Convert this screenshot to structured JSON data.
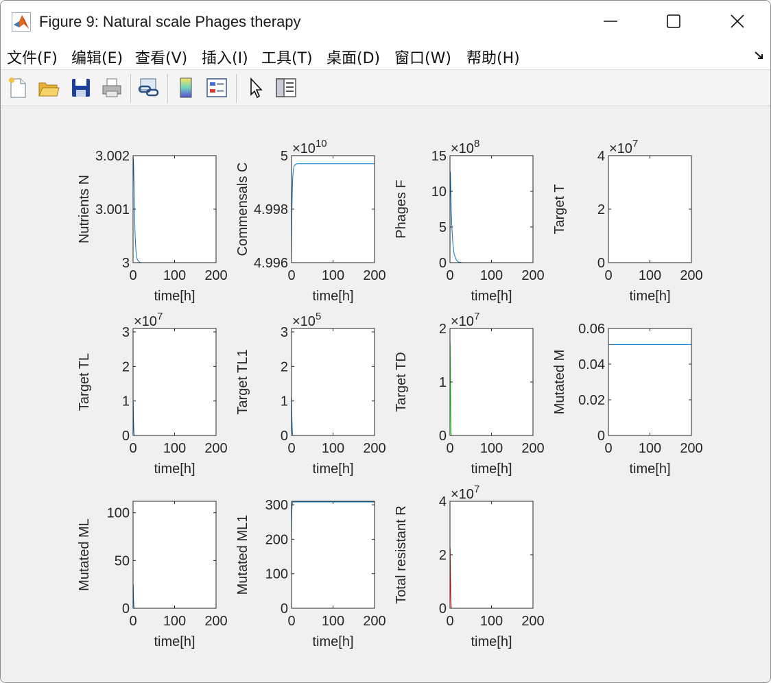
{
  "window": {
    "title": "Figure 9: Natural scale Phages therapy"
  },
  "menu": [
    {
      "label": "文件(F)",
      "mnemonic": "F"
    },
    {
      "label": "编辑(E)",
      "mnemonic": "E"
    },
    {
      "label": "查看(V)",
      "mnemonic": "V"
    },
    {
      "label": "插入(I)",
      "mnemonic": "I"
    },
    {
      "label": "工具(T)",
      "mnemonic": "T"
    },
    {
      "label": "桌面(D)",
      "mnemonic": "D"
    },
    {
      "label": "窗口(W)",
      "mnemonic": "W"
    },
    {
      "label": "帮助(H)",
      "mnemonic": "H"
    }
  ],
  "toolbar": {
    "icons": [
      "new-figure-icon",
      "open-file-icon",
      "save-icon",
      "print-icon",
      "link-plot-icon",
      "colorbar-icon",
      "legend-icon",
      "pointer-icon",
      "property-inspector-icon"
    ]
  },
  "colors": {
    "blue": "#0072bd",
    "green": "#00ff00",
    "red": "#ff0000"
  },
  "chart_data": [
    {
      "type": "line",
      "ylabel": "Nutrients N",
      "xlabel": "time[h]",
      "xlim": [
        0,
        200
      ],
      "ylim": [
        3,
        3.002
      ],
      "yticks": [
        "3",
        "3.001",
        "3.002"
      ],
      "xticks": [
        "0",
        "100",
        "200"
      ],
      "exponent": "",
      "color": "#0072bd",
      "series": [
        {
          "x": [
            0,
            1,
            2,
            3,
            4,
            5,
            7,
            10,
            15,
            20,
            30,
            200
          ],
          "y": [
            3.002,
            3.0019,
            3.0016,
            3.0012,
            3.0008,
            3.0005,
            3.0002,
            3.00006,
            3.00001,
            3.0,
            3.0,
            3.0
          ]
        }
      ]
    },
    {
      "type": "line",
      "ylabel": "Commensals C",
      "xlabel": "time[h]",
      "xlim": [
        0,
        200
      ],
      "ylim": [
        4.996,
        5
      ],
      "yticks": [
        "4.996",
        "4.998",
        "5"
      ],
      "xticks": [
        "0",
        "100",
        "200"
      ],
      "exponent": "10",
      "color": "#0072bd",
      "series": [
        {
          "x": [
            0,
            1,
            2,
            3,
            4,
            6,
            8,
            10,
            15,
            20,
            30,
            200
          ],
          "y": [
            4.9961,
            4.998,
            4.9988,
            4.9992,
            4.9994,
            4.9996,
            4.99965,
            4.99968,
            4.9997,
            4.9997,
            4.9997,
            4.9997
          ]
        }
      ]
    },
    {
      "type": "line",
      "ylabel": "Phages F",
      "xlabel": "time[h]",
      "xlim": [
        0,
        200
      ],
      "ylim": [
        0,
        15
      ],
      "yticks": [
        "0",
        "5",
        "10",
        "15"
      ],
      "xticks": [
        "0",
        "100",
        "200"
      ],
      "exponent": "8",
      "color": "#0072bd",
      "series": [
        {
          "x": [
            0,
            0.5,
            1,
            2,
            3,
            5,
            7,
            10,
            15,
            20,
            30,
            200
          ],
          "y": [
            0,
            12.8,
            12.5,
            10,
            7.5,
            4.5,
            2.6,
            1.2,
            0.4,
            0.1,
            0,
            0
          ]
        }
      ]
    },
    {
      "type": "line",
      "ylabel": "Target T",
      "xlabel": "time[h]",
      "xlim": [
        0,
        200
      ],
      "ylim": [
        0,
        4
      ],
      "yticks": [
        "0",
        "2",
        "4"
      ],
      "xticks": [
        "0",
        "100",
        "200"
      ],
      "exponent": "7",
      "color": "#0072bd",
      "series": [
        {
          "x": [
            0,
            200
          ],
          "y": [
            0,
            0
          ]
        }
      ]
    },
    {
      "type": "line",
      "ylabel": "Target TL",
      "xlabel": "time[h]",
      "xlim": [
        0,
        200
      ],
      "ylim": [
        0,
        3.1
      ],
      "yticks": [
        "0",
        "1",
        "2",
        "3"
      ],
      "xticks": [
        "0",
        "100",
        "200"
      ],
      "exponent": "7",
      "color": "#0072bd",
      "series": [
        {
          "x": [
            0,
            0.5,
            1,
            2,
            3,
            200
          ],
          "y": [
            0,
            1.0,
            0.5,
            0.1,
            0,
            0
          ]
        }
      ]
    },
    {
      "type": "line",
      "ylabel": "Target TL1",
      "xlabel": "time[h]",
      "xlim": [
        0,
        200
      ],
      "ylim": [
        0,
        3.1
      ],
      "yticks": [
        "0",
        "1",
        "2",
        "3"
      ],
      "xticks": [
        "0",
        "100",
        "200"
      ],
      "exponent": "5",
      "color": "#0072bd",
      "series": [
        {
          "x": [
            0,
            0.5,
            1,
            2,
            3,
            200
          ],
          "y": [
            0,
            1.1,
            0.5,
            0.1,
            0,
            0
          ]
        }
      ]
    },
    {
      "type": "line",
      "ylabel": "Target TD",
      "xlabel": "time[h]",
      "xlim": [
        0,
        200
      ],
      "ylim": [
        0,
        2
      ],
      "yticks": [
        "0",
        "1",
        "2"
      ],
      "xticks": [
        "0",
        "100",
        "200"
      ],
      "exponent": "7",
      "color": "#00ff00",
      "series": [
        {
          "x": [
            0,
            0.5,
            1,
            2,
            3,
            4,
            200
          ],
          "y": [
            1.75,
            1.7,
            1.2,
            0.4,
            0.05,
            0,
            0
          ]
        }
      ]
    },
    {
      "type": "line",
      "ylabel": "Mutated M",
      "xlabel": "time[h]",
      "xlim": [
        0,
        200
      ],
      "ylim": [
        0,
        0.06
      ],
      "yticks": [
        "0",
        "0.02",
        "0.04",
        "0.06"
      ],
      "xticks": [
        "0",
        "100",
        "200"
      ],
      "exponent": "",
      "color": "#0072bd",
      "series": [
        {
          "x": [
            0,
            200
          ],
          "y": [
            0.051,
            0.051
          ]
        }
      ]
    },
    {
      "type": "line",
      "ylabel": "Mutated ML",
      "xlabel": "time[h]",
      "xlim": [
        0,
        200
      ],
      "ylim": [
        0,
        112
      ],
      "yticks": [
        "0",
        "50",
        "100"
      ],
      "xticks": [
        "0",
        "100",
        "200"
      ],
      "exponent": "",
      "color": "#0072bd",
      "series": [
        {
          "x": [
            0,
            0.5,
            1,
            2,
            3,
            200
          ],
          "y": [
            0,
            25,
            10,
            2,
            0,
            0
          ]
        }
      ]
    },
    {
      "type": "line",
      "ylabel": "Mutated ML1",
      "xlabel": "time[h]",
      "xlim": [
        0,
        200
      ],
      "ylim": [
        0,
        310
      ],
      "yticks": [
        "0",
        "100",
        "200",
        "300"
      ],
      "xticks": [
        "0",
        "100",
        "200"
      ],
      "exponent": "",
      "color": "#0072bd",
      "series": [
        {
          "x": [
            0,
            0.5,
            1,
            2,
            3,
            5,
            200
          ],
          "y": [
            190,
            250,
            290,
            305,
            308,
            308,
            308
          ]
        }
      ]
    },
    {
      "type": "line",
      "ylabel": "Total resistant R",
      "xlabel": "time[h]",
      "xlim": [
        0,
        200
      ],
      "ylim": [
        0,
        4
      ],
      "yticks": [
        "0",
        "2",
        "4"
      ],
      "xticks": [
        "0",
        "100",
        "200"
      ],
      "exponent": "7",
      "color": "#ff0000",
      "series": [
        {
          "x": [
            0,
            0.5,
            1,
            2,
            3,
            4,
            200
          ],
          "y": [
            2.3,
            2.2,
            1.4,
            0.4,
            0.05,
            0,
            0
          ]
        }
      ]
    }
  ]
}
